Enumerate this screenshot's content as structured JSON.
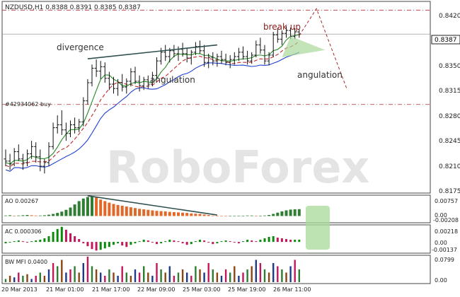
{
  "window": {
    "header": "NZDUSD,H1  0.8388 0.8391 0.8385 0.8387",
    "watermark": "RoboForex"
  },
  "annotations": {
    "divergence": "divergence",
    "angulation_left": "angulation",
    "angulation_right": "angulation",
    "break_up": "break up",
    "order": "#42934062 buy"
  },
  "panes": {
    "ao": "AO 0.00267",
    "ac": "AC 0.000306",
    "mfi": "BW MFI 0.0400"
  },
  "price_axis": {
    "labels": [
      "0.8420",
      "0.8387",
      "0.8350",
      "0.8315",
      "0.8280",
      "0.8245",
      "0.8210",
      "0.8175"
    ],
    "current": "0.8387"
  },
  "ao_axis": [
    "0.00757",
    "0.00",
    "-0.00208"
  ],
  "ac_axis": [
    "0.00218",
    "0.00",
    "-0.00137"
  ],
  "mfi_axis": [
    "0.0799",
    "0.00"
  ],
  "time_axis": [
    "20 Mar 2013",
    "21 Mar 01:00",
    "21 Mar 17:00",
    "22 Mar 09:00",
    "25 Mar 03:00",
    "25 Mar 19:00",
    "26 Mar 11:00"
  ],
  "colors": {
    "bull": "#2e7d32",
    "bear": "#e0692a",
    "ac_up": "#0a8a0a",
    "ac_down": "#c2185b",
    "ma_blue": "#1f3fd1",
    "ma_green": "#228b22",
    "ma_red": "#c62828",
    "level": "#b03030",
    "highlight": "#a8d99a"
  },
  "chart_data": {
    "type": "candlestick",
    "symbol": "NZDUSD",
    "timeframe": "H1",
    "ylim": [
      0.8168,
      0.8432
    ],
    "close_levels": [
      0.842,
      0.829
    ],
    "current_price": 0.8387,
    "ohlc_header": {
      "open": 0.8388,
      "high": 0.8391,
      "low": 0.8385,
      "close": 0.8387
    },
    "candles": [
      [
        0.8215,
        0.8228,
        0.8205,
        0.8212
      ],
      [
        0.8212,
        0.8222,
        0.82,
        0.8208
      ],
      [
        0.8208,
        0.823,
        0.8205,
        0.8225
      ],
      [
        0.8225,
        0.8235,
        0.8212,
        0.8215
      ],
      [
        0.8215,
        0.8222,
        0.82,
        0.821
      ],
      [
        0.821,
        0.8228,
        0.8205,
        0.8222
      ],
      [
        0.8222,
        0.824,
        0.8215,
        0.8232
      ],
      [
        0.8232,
        0.8238,
        0.821,
        0.8218
      ],
      [
        0.8218,
        0.8228,
        0.8198,
        0.8205
      ],
      [
        0.8205,
        0.8215,
        0.8195,
        0.821
      ],
      [
        0.821,
        0.8238,
        0.8205,
        0.8232
      ],
      [
        0.8232,
        0.8265,
        0.8228,
        0.8258
      ],
      [
        0.8258,
        0.8275,
        0.825,
        0.8262
      ],
      [
        0.8262,
        0.8282,
        0.8248,
        0.8255
      ],
      [
        0.8255,
        0.8265,
        0.824,
        0.825
      ],
      [
        0.825,
        0.8268,
        0.8245,
        0.8262
      ],
      [
        0.8262,
        0.8272,
        0.825,
        0.8258
      ],
      [
        0.8258,
        0.827,
        0.8252,
        0.8266
      ],
      [
        0.8266,
        0.83,
        0.826,
        0.8295
      ],
      [
        0.8295,
        0.8325,
        0.829,
        0.832
      ],
      [
        0.832,
        0.8345,
        0.8315,
        0.834
      ],
      [
        0.834,
        0.8352,
        0.8328,
        0.8336
      ],
      [
        0.8336,
        0.835,
        0.8325,
        0.8342
      ],
      [
        0.8342,
        0.8348,
        0.832,
        0.8326
      ],
      [
        0.8326,
        0.8335,
        0.831,
        0.8318
      ],
      [
        0.8318,
        0.8328,
        0.8305,
        0.8312
      ],
      [
        0.8312,
        0.8325,
        0.8302,
        0.832
      ],
      [
        0.832,
        0.8332,
        0.8308,
        0.8314
      ],
      [
        0.8314,
        0.8326,
        0.8305,
        0.8322
      ],
      [
        0.8322,
        0.834,
        0.8315,
        0.8335
      ],
      [
        0.8335,
        0.8342,
        0.8318,
        0.8322
      ],
      [
        0.8322,
        0.833,
        0.8308,
        0.8316
      ],
      [
        0.8316,
        0.8328,
        0.831,
        0.8324
      ],
      [
        0.8324,
        0.833,
        0.8312,
        0.8318
      ],
      [
        0.8318,
        0.8335,
        0.8315,
        0.833
      ],
      [
        0.833,
        0.8355,
        0.8326,
        0.835
      ],
      [
        0.835,
        0.8368,
        0.8345,
        0.8362
      ],
      [
        0.8362,
        0.8372,
        0.835,
        0.8356
      ],
      [
        0.8356,
        0.8368,
        0.8348,
        0.8364
      ],
      [
        0.8364,
        0.8372,
        0.8355,
        0.836
      ],
      [
        0.836,
        0.837,
        0.835,
        0.8366
      ],
      [
        0.8366,
        0.8375,
        0.8356,
        0.836
      ],
      [
        0.836,
        0.8368,
        0.8348,
        0.8354
      ],
      [
        0.8354,
        0.8365,
        0.8345,
        0.8362
      ],
      [
        0.8362,
        0.8376,
        0.8358,
        0.837
      ],
      [
        0.837,
        0.8378,
        0.836,
        0.8364
      ],
      [
        0.8364,
        0.8372,
        0.8342,
        0.8348
      ],
      [
        0.8348,
        0.836,
        0.834,
        0.8355
      ],
      [
        0.8355,
        0.8362,
        0.8344,
        0.835
      ],
      [
        0.835,
        0.836,
        0.8342,
        0.8356
      ],
      [
        0.8356,
        0.8364,
        0.8346,
        0.8352
      ],
      [
        0.8352,
        0.836,
        0.8344,
        0.8348
      ],
      [
        0.8348,
        0.8358,
        0.834,
        0.8352
      ],
      [
        0.8352,
        0.8362,
        0.8345,
        0.8356
      ],
      [
        0.8356,
        0.8368,
        0.835,
        0.8362
      ],
      [
        0.8362,
        0.837,
        0.8352,
        0.8356
      ],
      [
        0.8356,
        0.8364,
        0.8345,
        0.835
      ],
      [
        0.835,
        0.8362,
        0.8346,
        0.8358
      ],
      [
        0.8358,
        0.8378,
        0.8355,
        0.8372
      ],
      [
        0.8372,
        0.8382,
        0.836,
        0.8365
      ],
      [
        0.8365,
        0.8372,
        0.8345,
        0.835
      ],
      [
        0.835,
        0.8362,
        0.8344,
        0.8358
      ],
      [
        0.8358,
        0.839,
        0.8355,
        0.8386
      ],
      [
        0.8386,
        0.8395,
        0.8375,
        0.838
      ],
      [
        0.838,
        0.8392,
        0.8372,
        0.8388
      ],
      [
        0.8388,
        0.8398,
        0.8382,
        0.8392
      ],
      [
        0.8392,
        0.8396,
        0.838,
        0.8384
      ],
      [
        0.8384,
        0.8395,
        0.838,
        0.839
      ],
      [
        0.839,
        0.8394,
        0.8382,
        0.8387
      ]
    ],
    "forecast_path": [
      [
        68,
        0.8385
      ],
      [
        72,
        0.8422
      ],
      [
        79,
        0.8312
      ]
    ],
    "ao": [
      0.0002,
      0.0003,
      0.0001,
      0.0002,
      0.0003,
      0.0004,
      0.0003,
      0.0002,
      0.0002,
      0.0003,
      0.0005,
      0.0008,
      0.0012,
      0.0017,
      0.0024,
      0.0033,
      0.0045,
      0.0058,
      0.0068,
      0.0074,
      0.0076,
      0.0072,
      0.0064,
      0.0058,
      0.0052,
      0.0047,
      0.0043,
      0.004,
      0.0037,
      0.0034,
      0.0031,
      0.0028,
      0.0026,
      0.0024,
      0.0022,
      0.002,
      0.0019,
      0.0018,
      0.0016,
      0.0015,
      0.0014,
      0.0013,
      0.0012,
      0.001,
      0.0009,
      0.0008,
      0.0006,
      0.0004,
      0.0002,
      0.0001,
      0.0,
      -0.0001,
      -0.0001,
      0.0,
      0.0001,
      0.0001,
      0.0002,
      0.0002,
      0.0001,
      0.0001,
      0.0002,
      0.0004,
      0.0008,
      0.0013,
      0.0018,
      0.0022,
      0.0025,
      0.0026,
      0.00267
    ],
    "ac": [
      -0.0002,
      -0.0001,
      0.0001,
      0.0002,
      0.0001,
      -0.0001,
      0.0001,
      0.0002,
      0.0003,
      0.0005,
      0.0008,
      0.0014,
      0.0018,
      0.0021,
      0.0017,
      0.0012,
      0.0008,
      0.0004,
      -0.0002,
      -0.0006,
      -0.001,
      -0.0012,
      -0.0011,
      -0.0009,
      -0.0007,
      -0.0004,
      -0.0002,
      -0.0005,
      -0.0007,
      -0.0004,
      -0.0002,
      0.0001,
      0.0003,
      0.0002,
      -0.0001,
      -0.0003,
      -0.0002,
      0.0001,
      0.0003,
      0.0002,
      0.0001,
      -0.0002,
      -0.0004,
      -0.0003,
      0.0001,
      0.0003,
      0.0002,
      -0.0001,
      -0.0003,
      -0.0002,
      0.0001,
      0.0002,
      0.0001,
      -0.0001,
      -0.0002,
      0.0001,
      0.0003,
      0.0002,
      0.0001,
      0.0003,
      0.0005,
      0.0007,
      0.0008,
      0.0006,
      0.0005,
      0.0004,
      0.0003,
      0.0003,
      0.000306
    ],
    "mfi": [
      0.01,
      0.02,
      0.015,
      0.03,
      0.02,
      0.025,
      0.01,
      0.02,
      0.03,
      0.02,
      0.04,
      0.06,
      0.05,
      0.07,
      0.03,
      0.04,
      0.05,
      0.03,
      0.06,
      0.08,
      0.05,
      0.04,
      0.03,
      0.02,
      0.04,
      0.03,
      0.02,
      0.05,
      0.03,
      0.02,
      0.04,
      0.03,
      0.05,
      0.03,
      0.02,
      0.06,
      0.04,
      0.03,
      0.05,
      0.02,
      0.03,
      0.04,
      0.03,
      0.02,
      0.05,
      0.04,
      0.03,
      0.06,
      0.04,
      0.03,
      0.02,
      0.04,
      0.03,
      0.05,
      0.02,
      0.03,
      0.04,
      0.05,
      0.07,
      0.06,
      0.04,
      0.03,
      0.06,
      0.05,
      0.04,
      0.03,
      0.05,
      0.07,
      0.04
    ]
  }
}
